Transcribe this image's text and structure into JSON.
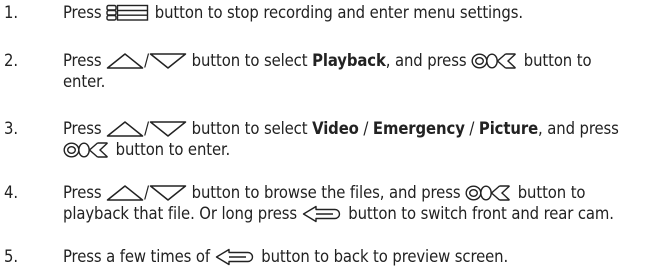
{
  "steps": [
    {
      "num": "1.",
      "lines": [
        {
          "press": "Press",
          "after_icon": "button to stop recording and enter menu settings."
        }
      ]
    },
    {
      "num": "2.",
      "lines": [
        {
          "press": "Press",
          "slash": "/",
          "a": "button to select",
          "bold": "Playback",
          "b": ", and press",
          "c": "button to"
        },
        {
          "text": "enter."
        }
      ]
    },
    {
      "num": "3.",
      "lines": [
        {
          "press": "Press",
          "slash": "/",
          "a": "button to select",
          "bold1": "Video",
          "sep1": " / ",
          "bold2": "Emergency",
          "sep2": " / ",
          "bold3": "Picture",
          "b": ", and press"
        },
        {
          "after_icon": "button to enter."
        }
      ]
    },
    {
      "num": "4.",
      "lines": [
        {
          "press": "Press",
          "slash": "/",
          "a": "button to browse the files, and press",
          "b": "button to"
        },
        {
          "a": "playback that file. Or long press",
          "b": "button to switch front and rear cam."
        }
      ]
    },
    {
      "num": "5.",
      "lines": [
        {
          "a": "Press a few times of",
          "b": "button to back to preview screen."
        }
      ]
    }
  ],
  "icons": {
    "menu": "menu-icon",
    "up": "up-triangle-icon",
    "down": "down-triangle-icon",
    "ok": "ok-icon",
    "back": "back-arrow-icon"
  }
}
